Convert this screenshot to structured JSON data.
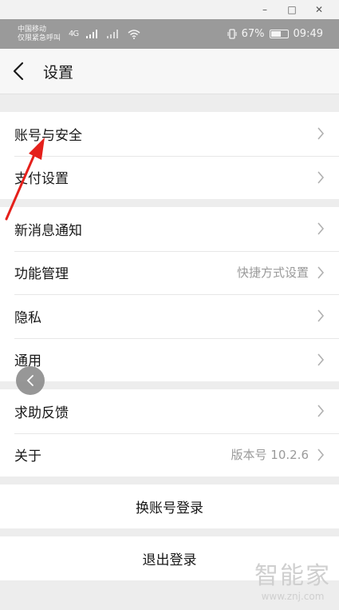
{
  "window_controls": {
    "minimize": "–",
    "maximize": "□",
    "close": "✕"
  },
  "status_bar": {
    "carrier_line1": "中国移动",
    "carrier_line2": "仅限紧急呼叫",
    "network": "4G",
    "battery_percent": "67%",
    "battery_level": 0.67,
    "time": "09:49"
  },
  "header": {
    "title": "设置"
  },
  "groups": [
    {
      "items": [
        {
          "label": "账号与安全",
          "value": ""
        },
        {
          "label": "支付设置",
          "value": ""
        }
      ]
    },
    {
      "items": [
        {
          "label": "新消息通知",
          "value": ""
        },
        {
          "label": "功能管理",
          "value": "快捷方式设置"
        },
        {
          "label": "隐私",
          "value": ""
        },
        {
          "label": "通用",
          "value": ""
        }
      ]
    },
    {
      "items": [
        {
          "label": "求助反馈",
          "value": ""
        },
        {
          "label": "关于",
          "value": "版本号 10.2.6"
        }
      ]
    }
  ],
  "actions": {
    "switch_account": "换账号登录",
    "logout": "退出登录"
  },
  "watermark": {
    "title": "智能家",
    "url": "www.znj.com"
  },
  "colors": {
    "annotation_arrow": "#e5201b"
  }
}
